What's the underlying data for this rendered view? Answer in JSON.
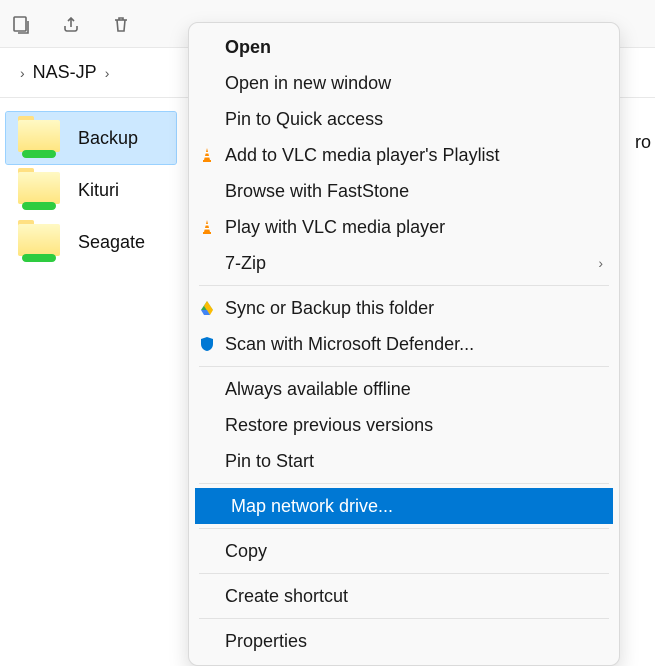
{
  "breadcrumb": {
    "location": "NAS-JP"
  },
  "folders": [
    {
      "name": "Backup",
      "selected": true
    },
    {
      "name": "Kituri",
      "selected": false
    },
    {
      "name": "Seagate",
      "selected": false
    }
  ],
  "right_hint": "ro",
  "context_menu": {
    "groups": [
      [
        {
          "label": "Open",
          "bold": true,
          "icon": null
        },
        {
          "label": "Open in new window",
          "icon": null
        },
        {
          "label": "Pin to Quick access",
          "icon": null
        },
        {
          "label": "Add to VLC media player's Playlist",
          "icon": "vlc-cone-icon"
        },
        {
          "label": "Browse with FastStone",
          "icon": null
        },
        {
          "label": "Play with VLC media player",
          "icon": "vlc-cone-icon"
        },
        {
          "label": "7-Zip",
          "icon": null,
          "submenu": true
        }
      ],
      [
        {
          "label": "Sync or Backup this folder",
          "icon": "drive-icon"
        },
        {
          "label": "Scan with Microsoft Defender...",
          "icon": "shield-icon"
        }
      ],
      [
        {
          "label": "Always available offline",
          "icon": null
        },
        {
          "label": "Restore previous versions",
          "icon": null
        },
        {
          "label": "Pin to Start",
          "icon": null
        }
      ],
      [
        {
          "label": "Map network drive...",
          "icon": null,
          "highlighted": true
        }
      ],
      [
        {
          "label": "Copy",
          "icon": null
        }
      ],
      [
        {
          "label": "Create shortcut",
          "icon": null
        }
      ],
      [
        {
          "label": "Properties",
          "icon": null
        }
      ]
    ]
  }
}
